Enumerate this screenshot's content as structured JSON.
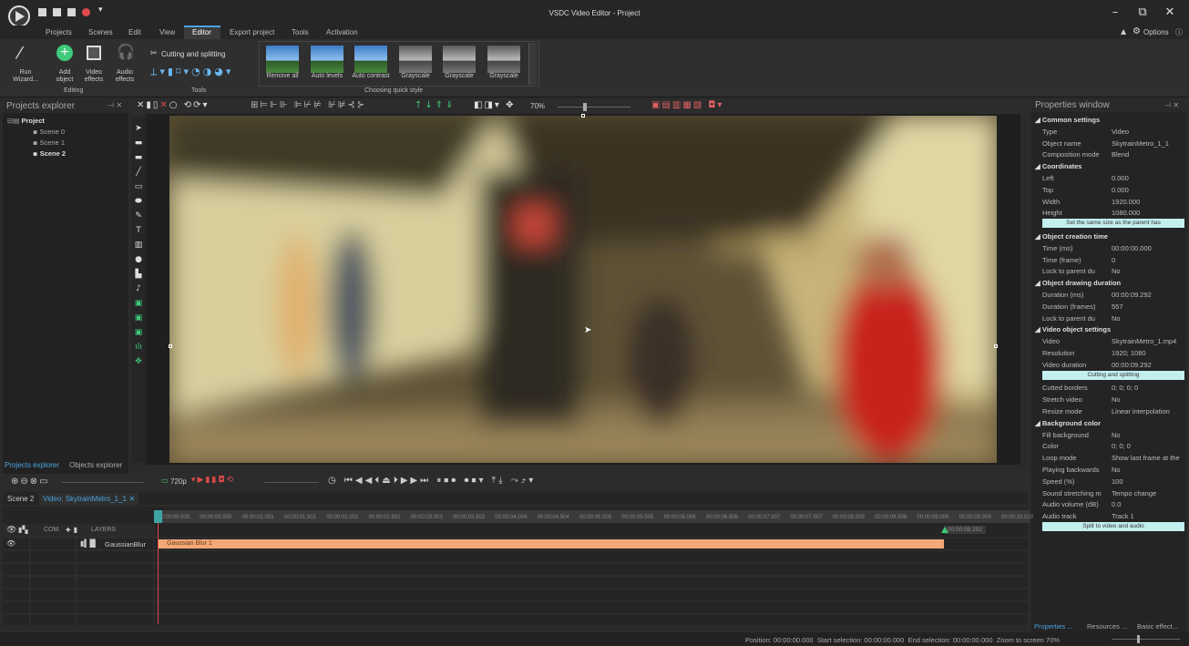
{
  "window": {
    "title": "VSDC Video Editor - Project",
    "options_label": "Options"
  },
  "menu": [
    "Projects",
    "Scenes",
    "Edit",
    "View",
    "Editor",
    "Export project",
    "Tools",
    "Activation"
  ],
  "ribbon": {
    "buttons": [
      {
        "label": "Run\nWizard..."
      },
      {
        "label": "Add\nobject"
      },
      {
        "label": "Video\neffects"
      },
      {
        "label": "Audio\neffects"
      }
    ],
    "editing_group": "Editing",
    "cutting_label": "Cutting and splitting",
    "tools_group": "Tools",
    "styles": [
      "Remove all",
      "Auto levels",
      "Auto contrast",
      "Grayscale",
      "Grayscale",
      "Grayscale"
    ],
    "styles_group": "Choosing quick style"
  },
  "projects": {
    "title": "Projects explorer",
    "root": "Project",
    "scenes": [
      "Scene 0",
      "Scene 1",
      "Scene 2"
    ],
    "tabs": [
      "Projects explorer",
      "Objects explorer"
    ]
  },
  "toolbar2": {
    "zoom": "70%"
  },
  "properties": {
    "title": "Properties window",
    "rows": [
      {
        "k": "Common settings",
        "sect": true
      },
      {
        "k": "Type",
        "v": "Video"
      },
      {
        "k": "Object name",
        "v": "SkytrainMetro_1_1"
      },
      {
        "k": "Composition mode",
        "v": "Blend"
      },
      {
        "k": "Coordinates",
        "sect": true
      },
      {
        "k": "Left",
        "v": "0.000"
      },
      {
        "k": "Top",
        "v": "0.000"
      },
      {
        "k": "Width",
        "v": "1920.000"
      },
      {
        "k": "Height",
        "v": "1080.000"
      },
      {
        "k": "Set the same size as the parent has",
        "btn": true
      },
      {
        "k": "Object creation time",
        "sect": true
      },
      {
        "k": "Time (ms)",
        "v": "00:00:00.000"
      },
      {
        "k": "Time (frame)",
        "v": "0"
      },
      {
        "k": "Lock to parent du",
        "v": "No"
      },
      {
        "k": "Object drawing duration",
        "sect": true
      },
      {
        "k": "Duration (ms)",
        "v": "00:00:09.292"
      },
      {
        "k": "Duration (frames)",
        "v": "557"
      },
      {
        "k": "Lock to parent du",
        "v": "No"
      },
      {
        "k": "Video object settings",
        "sect": true
      },
      {
        "k": "Video",
        "v": "SkytrainMetro_1.mp4"
      },
      {
        "k": "Resolution",
        "v": "1920; 1080"
      },
      {
        "k": "Video duration",
        "v": "00:00:09.292"
      },
      {
        "k": "Cutting and splitting",
        "btn": true
      },
      {
        "k": "Cutted borders",
        "v": "0; 0; 0; 0"
      },
      {
        "k": "Stretch video",
        "v": "No"
      },
      {
        "k": "Resize mode",
        "v": "Linear interpolation"
      },
      {
        "k": "Background color",
        "sect": true
      },
      {
        "k": "Fill background",
        "v": "No"
      },
      {
        "k": "Color",
        "v": "0; 0; 0"
      },
      {
        "k": "Loop mode",
        "v": "Show last frame at the"
      },
      {
        "k": "Playing backwards",
        "v": "No"
      },
      {
        "k": "Speed (%)",
        "v": "100"
      },
      {
        "k": "Sound stretching m",
        "v": "Tempo change"
      },
      {
        "k": "Audio volume (dB)",
        "v": "0.0"
      },
      {
        "k": "Audio track",
        "v": "Track 1"
      },
      {
        "k": "Split to video and audio",
        "btn": true
      }
    ],
    "bottom_tabs": [
      "Properties ...",
      "Resources ...",
      "Basic effect..."
    ]
  },
  "transport": {
    "resolution": "720p"
  },
  "timeline": {
    "tabs": [
      "Scene 2",
      "Video: SkytrainMetro_1_1"
    ],
    "ticks": [
      "00:00:00.000",
      "00:00:00.500",
      "00:00:01.001",
      "00:00:01.501",
      "00:00:02.002",
      "00:00:02.502",
      "00:00:03.003",
      "00:00:03.503",
      "00:00:04.004",
      "00:00:04.504",
      "00:00:05.005",
      "00:00:05.505",
      "00:00:06.006",
      "00:00:06.506",
      "00:00:07.007",
      "00:00:07.507",
      "00:00:08.008",
      "00:00:08.508",
      "00:00:09.009",
      "00:00:09.509",
      "00:00:10.010"
    ],
    "end_marker": "00:00:09.292",
    "layers_header": "LAYERS",
    "com_label": "COM.",
    "layer_name": "GaussianBlur",
    "clip": "Gaussian Blur 1"
  },
  "status": {
    "position_label": "Position:",
    "position": "00:00:00.000",
    "start_label": "Start selection:",
    "start": "00:00:00.000",
    "end_label": "End selection:",
    "end": "00:00:00.000",
    "zoom_label": "Zoom to screen",
    "zoom": "70%"
  }
}
